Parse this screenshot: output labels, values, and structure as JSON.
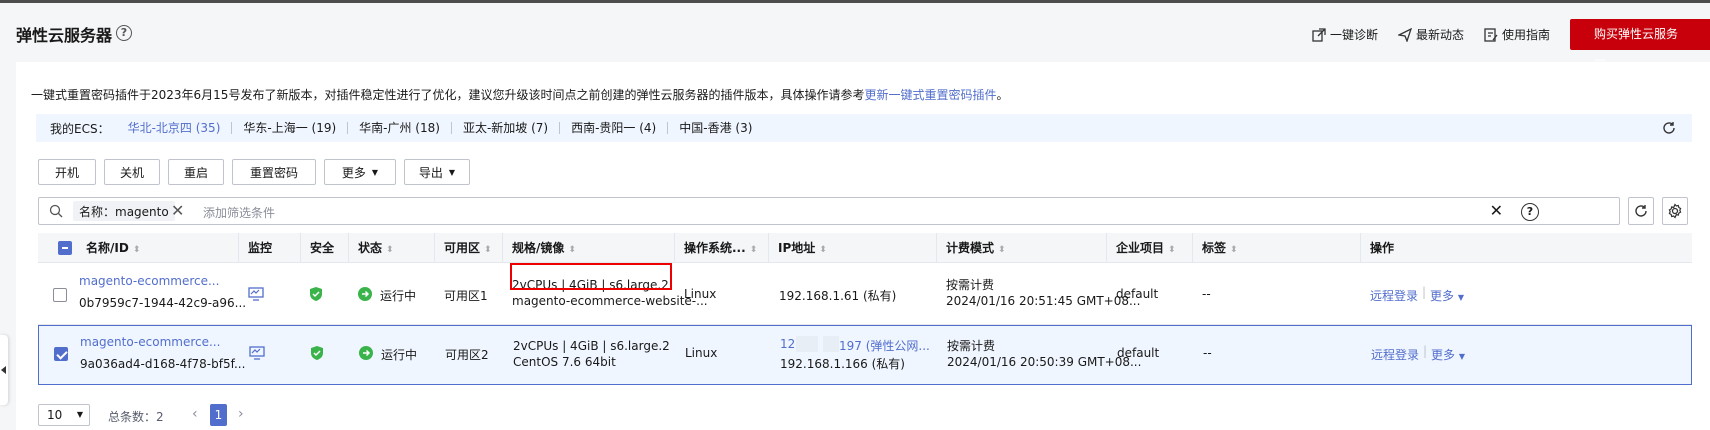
{
  "header": {
    "title": "弹性云服务器",
    "help": "?",
    "links": [
      {
        "label": "一键诊断",
        "icon": "external-link-icon"
      },
      {
        "label": "最新动态",
        "icon": "send-icon"
      },
      {
        "label": "使用指南",
        "icon": "guide-icon"
      }
    ],
    "buy_label": "购买弹性云服务器"
  },
  "notice": {
    "text": "一键式重置密码插件于2023年6月15号发布了新版本，对插件稳定性进行了优化，建议您升级该时间点之前创建的弹性云服务器的插件版本，具体操作请参考",
    "link": "更新一键式重置密码插件",
    "suffix": "。"
  },
  "regions": {
    "label": "我的ECS：",
    "items": [
      "华北-北京四 (35)",
      "华东-上海一 (19)",
      "华南-广州 (18)",
      "亚太-新加坡 (7)",
      "西南-贵阳一 (4)",
      "中国-香港 (3)"
    ]
  },
  "actions": {
    "start": "开机",
    "stop": "关机",
    "restart": "重启",
    "reset_password": "重置密码",
    "more": "更多",
    "export": "导出"
  },
  "search": {
    "chip": "名称：magento",
    "chip_close": "✕",
    "placeholder": "添加筛选条件",
    "clear": "✕",
    "help": "?"
  },
  "table": {
    "columns": [
      "名称/ID",
      "监控",
      "安全",
      "状态",
      "可用区",
      "规格/镜像",
      "操作系统...",
      "IP地址",
      "计费模式",
      "企业项目",
      "标签",
      "操作"
    ],
    "sort_mark": "⬍",
    "rows": [
      {
        "name": "magento-ecommerce...",
        "id": "0b7959c7-1944-42c9-a96...",
        "status": "运行中",
        "az": "可用区1",
        "spec": "2vCPUs | 4GiB | s6.large.2",
        "image": "magento-ecommerce-website-...",
        "os": "Linux",
        "ip1": "192.168.1.61 (私有)",
        "ip2": "",
        "billing": "按需计费",
        "billing_time": "2024/01/16 20:51:45 GMT+08...",
        "project": "default",
        "tags": "--",
        "op_login": "远程登录",
        "op_more": "更多",
        "selected": false
      },
      {
        "name": "magento-ecommerce...",
        "id": "9a036ad4-d168-4f78-bf5f...",
        "status": "运行中",
        "az": "可用区2",
        "spec": "2vCPUs | 4GiB | s6.large.2",
        "image": "CentOS 7.6 64bit",
        "os": "Linux",
        "ip1_prefix": "12",
        "ip1_suffix": "197 (弹性公网...",
        "ip2": "192.168.1.166 (私有)",
        "billing": "按需计费",
        "billing_time": "2024/01/16 20:50:39 GMT+08...",
        "project": "default",
        "tags": "--",
        "op_login": "远程登录",
        "op_more": "更多",
        "selected": true
      }
    ]
  },
  "pagination": {
    "page_size": "10",
    "total_label": "总条数：2",
    "prev": "‹",
    "current": "1",
    "next": "›"
  },
  "colors": {
    "brand_red": "#c7000b",
    "link_blue": "#526ecc",
    "status_green": "#3ab34a"
  }
}
